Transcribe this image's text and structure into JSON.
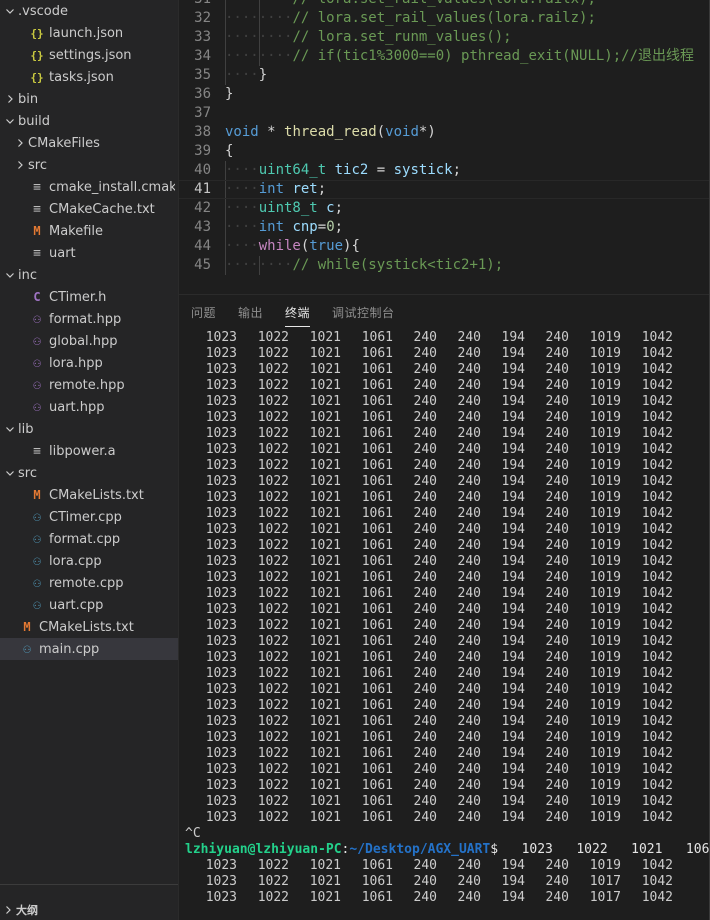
{
  "sidebar": {
    "tree": [
      {
        "label": ".vscode",
        "kind": "folder",
        "expanded": true,
        "indent": 0,
        "icon": "chevron-down-icon"
      },
      {
        "label": "launch.json",
        "kind": "file",
        "icon": "json-file-icon",
        "indent": 1,
        "glyph": "{}"
      },
      {
        "label": "settings.json",
        "kind": "file",
        "icon": "json-file-icon",
        "indent": 1,
        "glyph": "{}"
      },
      {
        "label": "tasks.json",
        "kind": "file",
        "icon": "json-file-icon",
        "indent": 1,
        "glyph": "{}"
      },
      {
        "label": "bin",
        "kind": "folder",
        "expanded": false,
        "indent": 0,
        "icon": "chevron-right-icon"
      },
      {
        "label": "build",
        "kind": "folder",
        "expanded": true,
        "indent": 0,
        "icon": "chevron-down-icon"
      },
      {
        "label": "CMakeFiles",
        "kind": "folder",
        "expanded": false,
        "indent": 1,
        "icon": "chevron-right-icon"
      },
      {
        "label": "src",
        "kind": "folder",
        "expanded": false,
        "indent": 1,
        "icon": "chevron-right-icon"
      },
      {
        "label": "cmake_install.cmake",
        "kind": "file",
        "icon": "cmake-file-icon",
        "indent": 1,
        "glyph": "≡"
      },
      {
        "label": "CMakeCache.txt",
        "kind": "file",
        "icon": "cmake-file-icon",
        "indent": 1,
        "glyph": "≡"
      },
      {
        "label": "Makefile",
        "kind": "file",
        "icon": "makefile-icon",
        "indent": 1,
        "glyph": "M"
      },
      {
        "label": "uart",
        "kind": "file",
        "icon": "binary-file-icon",
        "indent": 1,
        "glyph": "≡"
      },
      {
        "label": "inc",
        "kind": "folder",
        "expanded": true,
        "indent": 0,
        "icon": "chevron-down-icon"
      },
      {
        "label": "CTimer.h",
        "kind": "file",
        "icon": "c-header-icon",
        "indent": 1,
        "glyph": "C"
      },
      {
        "label": "format.hpp",
        "kind": "file",
        "icon": "cpp-header-icon",
        "indent": 1,
        "glyph": "⚇"
      },
      {
        "label": "global.hpp",
        "kind": "file",
        "icon": "cpp-header-icon",
        "indent": 1,
        "glyph": "⚇"
      },
      {
        "label": "lora.hpp",
        "kind": "file",
        "icon": "cpp-header-icon",
        "indent": 1,
        "glyph": "⚇"
      },
      {
        "label": "remote.hpp",
        "kind": "file",
        "icon": "cpp-header-icon",
        "indent": 1,
        "glyph": "⚇"
      },
      {
        "label": "uart.hpp",
        "kind": "file",
        "icon": "cpp-header-icon",
        "indent": 1,
        "glyph": "⚇"
      },
      {
        "label": "lib",
        "kind": "folder",
        "expanded": true,
        "indent": 0,
        "icon": "chevron-down-icon"
      },
      {
        "label": "libpower.a",
        "kind": "file",
        "icon": "library-file-icon",
        "indent": 1,
        "glyph": "≡"
      },
      {
        "label": "src",
        "kind": "folder",
        "expanded": true,
        "indent": 0,
        "icon": "chevron-down-icon"
      },
      {
        "label": "CMakeLists.txt",
        "kind": "file",
        "icon": "cmakelists-icon",
        "indent": 1,
        "glyph": "M"
      },
      {
        "label": "CTimer.cpp",
        "kind": "file",
        "icon": "cpp-source-icon",
        "indent": 1,
        "glyph": "⚇"
      },
      {
        "label": "format.cpp",
        "kind": "file",
        "icon": "cpp-source-icon",
        "indent": 1,
        "glyph": "⚇"
      },
      {
        "label": "lora.cpp",
        "kind": "file",
        "icon": "cpp-source-icon",
        "indent": 1,
        "glyph": "⚇"
      },
      {
        "label": "remote.cpp",
        "kind": "file",
        "icon": "cpp-source-icon",
        "indent": 1,
        "glyph": "⚇"
      },
      {
        "label": "uart.cpp",
        "kind": "file",
        "icon": "cpp-source-icon",
        "indent": 1,
        "glyph": "⚇"
      },
      {
        "label": "CMakeLists.txt",
        "kind": "file",
        "icon": "cmakelists-icon",
        "indent": 0,
        "glyph": "M"
      },
      {
        "label": "main.cpp",
        "kind": "file",
        "icon": "cpp-source-icon",
        "indent": 0,
        "glyph": "⚇",
        "selected": true
      }
    ],
    "outline": {
      "label": "大纲",
      "icon": "chevron-right-icon"
    }
  },
  "editor": {
    "first_visible_line": 31,
    "current_line": 41,
    "lines": [
      {
        "n": 31,
        "indent_dots": 8,
        "guides": 2,
        "segments": [
          {
            "t": "// lora.set_rail_values(lora.railx);",
            "c": "cm"
          }
        ]
      },
      {
        "n": 32,
        "indent_dots": 8,
        "guides": 2,
        "segments": [
          {
            "t": "// lora.set_rail_values(lora.railz);",
            "c": "cm"
          }
        ]
      },
      {
        "n": 33,
        "indent_dots": 8,
        "guides": 2,
        "segments": [
          {
            "t": "// lora.set_runm_values();",
            "c": "cm"
          }
        ]
      },
      {
        "n": 34,
        "indent_dots": 8,
        "guides": 2,
        "segments": [
          {
            "t": "// if(tic1%3000==0) pthread_exit(NULL);//退出线程",
            "c": "cm"
          }
        ]
      },
      {
        "n": 35,
        "indent_dots": 4,
        "guides": 1,
        "segments": [
          {
            "t": "}",
            "c": "pl"
          }
        ]
      },
      {
        "n": 36,
        "indent_dots": 0,
        "guides": 0,
        "segments": [
          {
            "t": "}",
            "c": "pl"
          }
        ]
      },
      {
        "n": 37,
        "indent_dots": 0,
        "guides": 0,
        "segments": []
      },
      {
        "n": 38,
        "indent_dots": 0,
        "guides": 0,
        "segments": [
          {
            "t": "void",
            "c": "kw"
          },
          {
            "t": " * ",
            "c": "pl"
          },
          {
            "t": "thread_read",
            "c": "fn"
          },
          {
            "t": "(",
            "c": "pl"
          },
          {
            "t": "void",
            "c": "kw"
          },
          {
            "t": "*)",
            "c": "pl"
          }
        ]
      },
      {
        "n": 39,
        "indent_dots": 0,
        "guides": 0,
        "segments": [
          {
            "t": "{",
            "c": "pl"
          }
        ]
      },
      {
        "n": 40,
        "indent_dots": 4,
        "guides": 1,
        "segments": [
          {
            "t": "uint64_t",
            "c": "ty"
          },
          {
            "t": " ",
            "c": "pl"
          },
          {
            "t": "tic2",
            "c": "vr"
          },
          {
            "t": " = ",
            "c": "pl"
          },
          {
            "t": "systick",
            "c": "vr"
          },
          {
            "t": ";",
            "c": "pl"
          }
        ]
      },
      {
        "n": 41,
        "indent_dots": 4,
        "guides": 1,
        "current": true,
        "segments": [
          {
            "t": "int",
            "c": "kw"
          },
          {
            "t": " ",
            "c": "pl"
          },
          {
            "t": "ret",
            "c": "vr"
          },
          {
            "t": ";",
            "c": "pl"
          }
        ]
      },
      {
        "n": 42,
        "indent_dots": 4,
        "guides": 1,
        "segments": [
          {
            "t": "uint8_t",
            "c": "ty"
          },
          {
            "t": " ",
            "c": "pl"
          },
          {
            "t": "c",
            "c": "vr"
          },
          {
            "t": ";",
            "c": "pl"
          }
        ]
      },
      {
        "n": 43,
        "indent_dots": 4,
        "guides": 1,
        "segments": [
          {
            "t": "int",
            "c": "kw"
          },
          {
            "t": " ",
            "c": "pl"
          },
          {
            "t": "cnp",
            "c": "vr"
          },
          {
            "t": "=",
            "c": "pl"
          },
          {
            "t": "0",
            "c": "nm"
          },
          {
            "t": ";",
            "c": "pl"
          }
        ]
      },
      {
        "n": 44,
        "indent_dots": 4,
        "guides": 1,
        "segments": [
          {
            "t": "while",
            "c": "kw2"
          },
          {
            "t": "(",
            "c": "pl"
          },
          {
            "t": "true",
            "c": "kw"
          },
          {
            "t": "){",
            "c": "pl"
          }
        ]
      },
      {
        "n": 45,
        "indent_dots": 8,
        "guides": 2,
        "segments": [
          {
            "t": "// while(systick<tic2+1);",
            "c": "cm"
          }
        ]
      }
    ]
  },
  "panel": {
    "tabs": [
      {
        "label": "问题",
        "active": false
      },
      {
        "label": "输出",
        "active": false
      },
      {
        "label": "终端",
        "active": true
      },
      {
        "label": "调试控制台",
        "active": false
      }
    ],
    "terminal": {
      "data_row": [
        "1023",
        "1022",
        "1021",
        "1061",
        "240",
        "240",
        "194",
        "240",
        "1019",
        "1042"
      ],
      "data_row_alt": [
        "1023",
        "1022",
        "1021",
        "1061",
        "240",
        "240",
        "194",
        "240",
        "1017",
        "1042"
      ],
      "data_row_count": 31,
      "interrupt_text": "^C",
      "prompt": {
        "user_host": "lzhiyuan@lzhiyuan-PC",
        "separator": ":",
        "path": "~/Desktop/AGX_UART",
        "dollar": "$",
        "trailing": "   1023   1022   1021   106"
      },
      "tail_rows": [
        [
          "1023",
          "1022",
          "1021",
          "1061",
          "240",
          "240",
          "194",
          "240",
          "1019",
          "1042"
        ],
        [
          "1023",
          "1022",
          "1021",
          "1061",
          "240",
          "240",
          "194",
          "240",
          "1017",
          "1042"
        ],
        [
          "1023",
          "1022",
          "1021",
          "1061",
          "240",
          "240",
          "194",
          "240",
          "1017",
          "1042"
        ]
      ]
    }
  },
  "colors": {
    "sidebar_bg": "#252526",
    "editor_bg": "#1e1e1e",
    "selected_row": "#37373d",
    "comment_green": "#6A9955",
    "keyword_blue": "#569cd6",
    "type_teal": "#4EC9B0",
    "terminal_user_green": "#23d18b",
    "terminal_path_blue": "#2472c8"
  }
}
